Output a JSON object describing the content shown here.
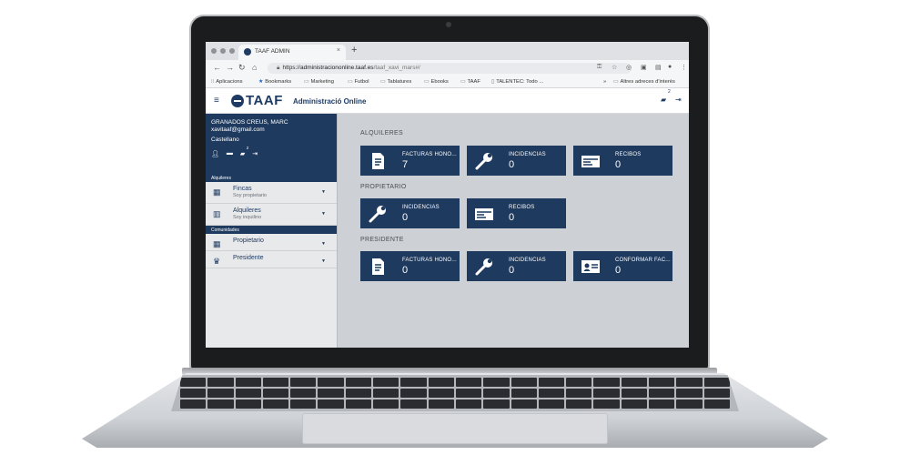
{
  "browser": {
    "tab_title": "TAAF ADMIN",
    "tab_close": "×",
    "new_tab": "+",
    "url_scheme": "https://",
    "url_host": "administraciononline.taaf.es",
    "url_path": "/taaf_xavi_mars#/",
    "bookmarks": [
      {
        "label": "Aplicacions",
        "icon": "apps-grid-icon"
      },
      {
        "label": "Bookmarks",
        "icon": "star-icon"
      },
      {
        "label": "Marketing",
        "icon": "folder-icon"
      },
      {
        "label": "Futbol",
        "icon": "folder-icon"
      },
      {
        "label": "Tablatures",
        "icon": "folder-icon"
      },
      {
        "label": "Ebooks",
        "icon": "folder-icon"
      },
      {
        "label": "TAAF",
        "icon": "folder-icon"
      },
      {
        "label": "TALENTEC: Todo ...",
        "icon": "page-icon"
      }
    ],
    "bookmarks_overflow": "»",
    "other_bookmarks": "Altres adreces d'interès"
  },
  "app": {
    "logo": "TAAF",
    "title": "Administració Online",
    "notification_count": "2"
  },
  "user": {
    "name": "GRANADOS CREUS, MARC",
    "email": "xavitaaf@gmail.com",
    "language": "Castellano",
    "message_count": "2"
  },
  "sidebar": {
    "section_alquileres": "Alquileres",
    "fincas_label": "Fincas",
    "fincas_sub": "Soy propietario",
    "alquileres_label": "Alquileres",
    "alquileres_sub": "Soy inquilino",
    "section_comunidades": "Comunidades",
    "propietario_label": "Propietario",
    "presidente_label": "Presidente"
  },
  "groups": [
    {
      "title": "ALQUILERES",
      "cards": [
        {
          "label": "FACTURAS HONO...",
          "count": "7",
          "icon": "document-icon"
        },
        {
          "label": "INCIDENCIAS",
          "count": "0",
          "icon": "wrench-icon"
        },
        {
          "label": "RECIBOS",
          "count": "0",
          "icon": "receipt-icon"
        }
      ]
    },
    {
      "title": "PROPIETARIO",
      "cards": [
        {
          "label": "INCIDENCIAS",
          "count": "0",
          "icon": "wrench-icon"
        },
        {
          "label": "RECIBOS",
          "count": "0",
          "icon": "receipt-icon"
        }
      ]
    },
    {
      "title": "PRESIDENTE",
      "cards": [
        {
          "label": "FACTURAS HONO...",
          "count": "0",
          "icon": "document-icon"
        },
        {
          "label": "INCIDENCIAS",
          "count": "0",
          "icon": "wrench-icon"
        },
        {
          "label": "CONFORMAR FAC...",
          "count": "0",
          "icon": "id-card-icon"
        }
      ]
    }
  ],
  "colors": {
    "brand_navy": "#1e3a5f",
    "content_bg": "#cdd0d4"
  }
}
